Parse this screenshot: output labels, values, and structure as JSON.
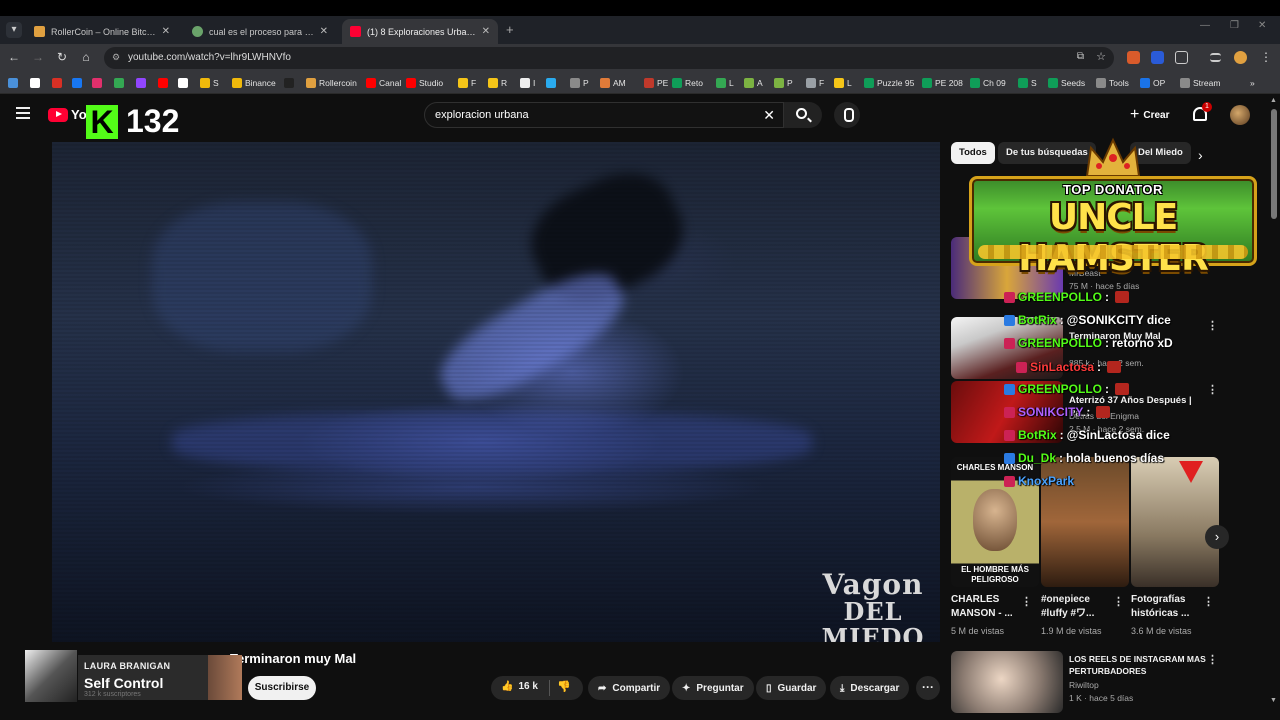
{
  "browser": {
    "tabs": [
      {
        "title": "RollerCoin – Online Bitcoin Mining",
        "fav": "#e0a040",
        "active": false
      },
      {
        "title": "cual es el proceso para cremar",
        "fav": "#6aa36a",
        "active": false
      },
      {
        "title": "(1) 8 Exploraciones Urbanas que",
        "fav": "#ff0033",
        "active": true
      }
    ],
    "url": "youtube.com/watch?v=lhr9LWHNVfo",
    "bookmarks": [
      {
        "label": "",
        "color": "#4a90d9"
      },
      {
        "label": "",
        "color": "#ffffff"
      },
      {
        "label": "",
        "color": "#d93025"
      },
      {
        "label": "",
        "color": "#e1306c"
      },
      {
        "label": "",
        "color": "#1877f2"
      },
      {
        "label": "",
        "color": "#34a853"
      },
      {
        "label": "",
        "color": "#9146ff"
      },
      {
        "label": "",
        "color": "#ff0000"
      },
      {
        "label": "",
        "color": "#ffffff"
      },
      {
        "label": "S",
        "color": "#f0b90b"
      },
      {
        "label": "Binance",
        "color": "#f0b90b"
      },
      {
        "label": "",
        "color": "#222222"
      },
      {
        "label": "Rollercoin",
        "color": "#e0a040"
      },
      {
        "label": "Canal",
        "color": "#ff0000"
      },
      {
        "label": "Studio",
        "color": "#ff0000"
      },
      {
        "label": "F",
        "color": "#f5c518"
      },
      {
        "label": "R",
        "color": "#f5c518"
      },
      {
        "label": "",
        "color": "#2aabee"
      },
      {
        "label": "I",
        "color": "#eeeeee"
      },
      {
        "label": "P",
        "color": "#8a8a8a"
      },
      {
        "label": "AM",
        "color": "#e07b39"
      },
      {
        "label": "PE",
        "color": "#c0392b"
      },
      {
        "label": "Reto",
        "color": "#0f9d58"
      },
      {
        "label": "L",
        "color": "#34a853"
      },
      {
        "label": "A",
        "color": "#7cb342"
      },
      {
        "label": "P",
        "color": "#7cb342"
      },
      {
        "label": "F",
        "color": "#9aa0a6"
      },
      {
        "label": "L",
        "color": "#f5c518"
      },
      {
        "label": "Puzzle 95",
        "color": "#0f9d58"
      },
      {
        "label": "PE 208",
        "color": "#0f9d58"
      },
      {
        "label": "Ch 09",
        "color": "#0f9d58"
      },
      {
        "label": "S",
        "color": "#0f9d58"
      },
      {
        "label": "Seeds",
        "color": "#0f9d58"
      },
      {
        "label": "Tools",
        "color": "#8a8a8a"
      },
      {
        "label": "OP",
        "color": "#1a73e8"
      },
      {
        "label": "Stream",
        "color": "#8a8a8a"
      }
    ]
  },
  "youtube": {
    "logo_text": "You",
    "kick_badge": {
      "letter": "K",
      "number": "132"
    },
    "search": {
      "query": "exploracion urbana"
    },
    "create_label": "Crear",
    "notif_count": "1"
  },
  "video": {
    "watermark_line1": "Vagon",
    "watermark_line2": "DEL MIEDO",
    "title": "Terminaron muy Mal",
    "channel_overlay": {
      "artist": "LAURA BRANIGAN",
      "song": "Self Control",
      "subs": "312 k suscriptores"
    },
    "subscribe_label": "Suscribirse",
    "likes": "16 k",
    "actions": [
      "Preguntar",
      "Guardar",
      "Descargar"
    ],
    "share_label": "Compartir"
  },
  "sidebar": {
    "chips": [
      {
        "label": "Todos",
        "on": true
      },
      {
        "label": "De tus búsquedas",
        "on": false
      },
      {
        "label": "Del Miedo",
        "on": false
      }
    ],
    "recommendations": [
      {
        "title": "",
        "channel": "MrBeast",
        "meta": "75 M · hace 5 días"
      },
      {
        "title": "Terminaron Muy Mal",
        "channel": "",
        "meta": "885 k · hace 2 sem."
      },
      {
        "title": "Aterrizó 37 Años Después | Pa...",
        "channel": "Detrás del Enigma",
        "meta": "2.5 M · hace 2 sem."
      }
    ],
    "shorts": [
      {
        "caption": "CHARLES MANSON - ...",
        "views": "5 M de vistas",
        "label_top": "CHARLES MANSON",
        "label_bottom": "EL HOMBRE MÁS PELIGROSO"
      },
      {
        "caption": "#onepiece #luffy #ワ...",
        "views": "1.9 M de vistas"
      },
      {
        "caption": "Fotografías históricas ...",
        "views": "3.6 M de vistas"
      }
    ],
    "last_rec": {
      "title": "LOS REELS DE INSTAGRAM MAS PERTURBADORES",
      "channel": "Riwiltop",
      "meta": "1 K · hace 5 días"
    }
  },
  "stream_overlay": {
    "banner_top": "TOP DONATOR",
    "banner_name": "UNCLE HAMSTER",
    "chat": [
      {
        "user": "GREENPOLLO",
        "sep": " :",
        "msg": "",
        "color": "#53fc18"
      },
      {
        "user": "BotRix",
        "sep": " :",
        "msg": "@SONIKCITY dice",
        "color": "#53fc18"
      },
      {
        "user": "GREENPOLLO",
        "sep": " :",
        "msg": "retorno xD",
        "color": "#53fc18"
      },
      {
        "user": "SinLactosa",
        "sep": " :",
        "msg": "",
        "color": "#ff3b3b"
      },
      {
        "user": "GREENPOLLO",
        "sep": " :",
        "msg": "",
        "color": "#53fc18"
      },
      {
        "user": "SONIKCITY",
        "sep": " :",
        "msg": "",
        "color": "#b061ff"
      },
      {
        "user": "BotRix",
        "sep": " :",
        "msg": "@SinLactosa dice",
        "color": "#53fc18"
      },
      {
        "user": "Du_Dk",
        "sep": " :",
        "msg": "hola buenos días",
        "color": "#53fc18"
      },
      {
        "user": "KnoxPark",
        "sep": "",
        "msg": "",
        "color": "#4aa3ff"
      }
    ]
  }
}
